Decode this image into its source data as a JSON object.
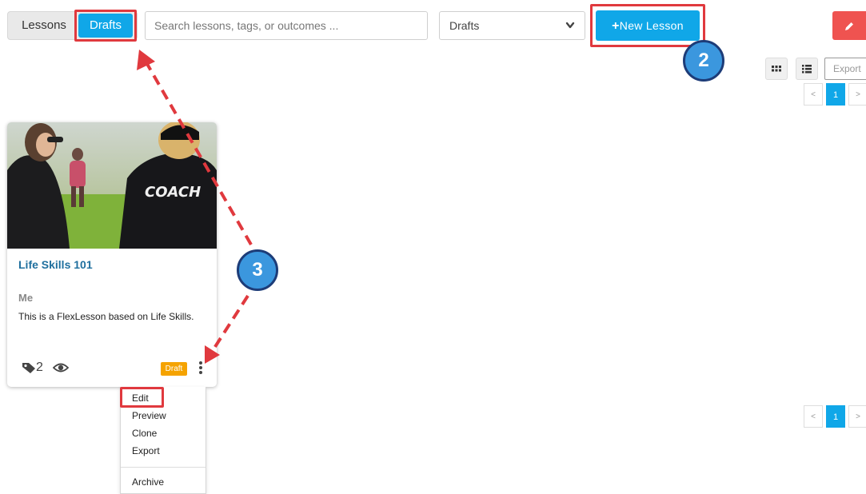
{
  "toolbar": {
    "tab_lessons": "Lessons",
    "tab_drafts": "Drafts",
    "search_placeholder": "Search lessons, tags, or outcomes ...",
    "filter_selected": "Drafts",
    "new_lesson_label": "New Lesson",
    "export_placeholder": "Export"
  },
  "pagination": {
    "prev": "<",
    "current": "1",
    "next": ">"
  },
  "card": {
    "title": "Life Skills 101",
    "author": "Me",
    "description": "This is a FlexLesson based on Life Skills.",
    "image_text": "COACH",
    "tag_count": "2",
    "status_badge": "Draft"
  },
  "card_menu": {
    "items": [
      "Edit",
      "Preview",
      "Clone",
      "Export",
      "Archive"
    ]
  },
  "annotations": {
    "callout_2": "2",
    "callout_3": "3",
    "highlight_color": "#e0393e",
    "callout_color": "#3b97de"
  },
  "colors": {
    "accent": "#10a7e8",
    "danger": "#ef5350",
    "draft_badge": "#f5a300",
    "title_link": "#1f6f9e"
  },
  "icons": [
    "chevron-down-icon",
    "plus-icon",
    "pencil-icon",
    "grid-view-icon",
    "list-view-icon",
    "tag-icon",
    "eye-icon",
    "kebab-menu-icon"
  ]
}
